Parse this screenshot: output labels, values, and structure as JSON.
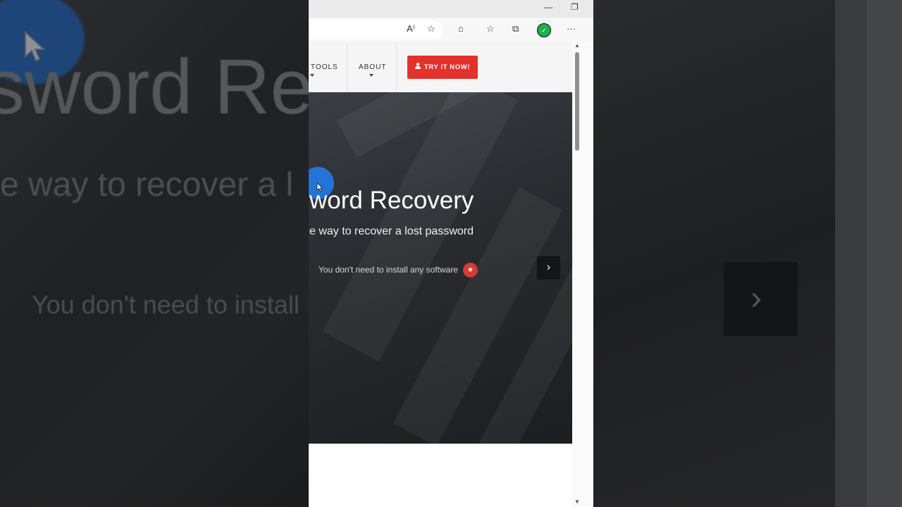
{
  "backdrop": {
    "ghost_line1": "sword Re",
    "ghost_line2": "e way to recover a l",
    "ghost_line3": "You don't need to install",
    "ghost_arrow": "›"
  },
  "browser": {
    "window_controls": {
      "minimize": "—",
      "restore": "❐"
    },
    "toolbar_icons": [
      "read-aloud-icon",
      "add-favorite-icon",
      "extensions-icon",
      "favorites-icon",
      "collections-icon",
      "profile-icon",
      "more-icon"
    ],
    "toolbar_glyphs": {
      "read_aloud": "A⁾",
      "add_favorite": "☆",
      "extensions": "⌂",
      "favorites": "☆",
      "collections": "⧉",
      "profile": "✓",
      "more": "···"
    }
  },
  "site": {
    "nav": {
      "tools_label": "TOOLS",
      "about_label": "ABOUT",
      "cta_label": "TRY IT NOW!",
      "cta_icon": "👤"
    },
    "hero": {
      "title": "word Recovery",
      "subtitle": "e way to recover a lost password",
      "caption": "You don't need to install any software",
      "star_glyph": "★",
      "next_glyph": "›"
    }
  },
  "colors": {
    "cta_red": "#e2322b",
    "star_badge": "#d83a36",
    "click_indicator": "#2374d6",
    "profile_green": "#1cb14a"
  }
}
